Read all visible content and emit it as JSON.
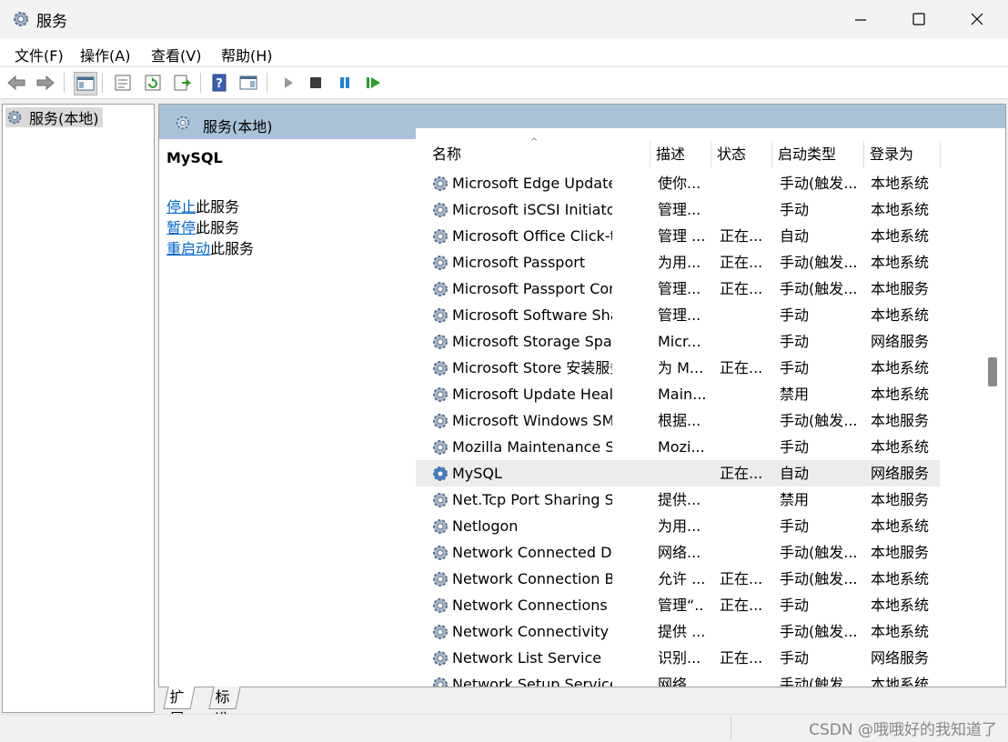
{
  "window": {
    "title": "服务"
  },
  "menu": [
    "文件(F)",
    "操作(A)",
    "查看(V)",
    "帮助(H)"
  ],
  "tree": {
    "selected_label": "服务(本地)"
  },
  "main": {
    "header_title": "服务(本地)",
    "selected_service": "MySQL",
    "actions": [
      {
        "link": "停止",
        "suffix": "此服务"
      },
      {
        "link": "暂停",
        "suffix": "此服务"
      },
      {
        "link": "重启动",
        "suffix": "此服务"
      }
    ]
  },
  "columns": [
    "名称",
    "描述",
    "状态",
    "启动类型",
    "登录为"
  ],
  "rows": [
    {
      "name": "Microsoft Edge Update Ser...",
      "desc": "使你...",
      "status": "",
      "startup": "手动(触发...",
      "login": "本地系统"
    },
    {
      "name": "Microsoft iSCSI Initiator Ser...",
      "desc": "管理...",
      "status": "",
      "startup": "手动",
      "login": "本地系统"
    },
    {
      "name": "Microsoft Office Click-to-R...",
      "desc": "管理 ...",
      "status": "正在...",
      "startup": "自动",
      "login": "本地系统"
    },
    {
      "name": "Microsoft Passport",
      "desc": "为用...",
      "status": "正在...",
      "startup": "手动(触发...",
      "login": "本地系统"
    },
    {
      "name": "Microsoft Passport Container",
      "desc": "管理...",
      "status": "正在...",
      "startup": "手动(触发...",
      "login": "本地服务"
    },
    {
      "name": "Microsoft Software Shado...",
      "desc": "管理...",
      "status": "",
      "startup": "手动",
      "login": "本地系统"
    },
    {
      "name": "Microsoft Storage Spaces S...",
      "desc": "Micr...",
      "status": "",
      "startup": "手动",
      "login": "网络服务"
    },
    {
      "name": "Microsoft Store 安装服务",
      "desc": "为 M...",
      "status": "正在...",
      "startup": "手动",
      "login": "本地系统"
    },
    {
      "name": "Microsoft Update Health S...",
      "desc": "Main...",
      "status": "",
      "startup": "禁用",
      "login": "本地系统"
    },
    {
      "name": "Microsoft Windows SMS 路...",
      "desc": "根据...",
      "status": "",
      "startup": "手动(触发...",
      "login": "本地服务"
    },
    {
      "name": "Mozilla Maintenance Service",
      "desc": "Mozi...",
      "status": "",
      "startup": "手动",
      "login": "本地系统"
    },
    {
      "name": "MySQL",
      "desc": "",
      "status": "正在...",
      "startup": "自动",
      "login": "网络服务",
      "selected": true
    },
    {
      "name": "Net.Tcp Port Sharing Service",
      "desc": "提供...",
      "status": "",
      "startup": "禁用",
      "login": "本地服务"
    },
    {
      "name": "Netlogon",
      "desc": "为用...",
      "status": "",
      "startup": "手动",
      "login": "本地系统"
    },
    {
      "name": "Network Connected Devic...",
      "desc": "网络...",
      "status": "",
      "startup": "手动(触发...",
      "login": "本地服务"
    },
    {
      "name": "Network Connection Broker",
      "desc": "允许 ...",
      "status": "正在...",
      "startup": "手动(触发...",
      "login": "本地系统"
    },
    {
      "name": "Network Connections",
      "desc": "管理“...",
      "status": "正在...",
      "startup": "手动",
      "login": "本地系统"
    },
    {
      "name": "Network Connectivity Assis...",
      "desc": "提供 ...",
      "status": "",
      "startup": "手动(触发...",
      "login": "本地系统"
    },
    {
      "name": "Network List Service",
      "desc": "识别...",
      "status": "正在...",
      "startup": "手动",
      "login": "网络服务"
    },
    {
      "name": "Network Setup Service",
      "desc": "网络...",
      "status": "",
      "startup": "手动(触发...",
      "login": "本地系统"
    }
  ],
  "tabs": [
    "扩展",
    "标准"
  ],
  "watermark": "CSDN @哦哦好的我知道了"
}
